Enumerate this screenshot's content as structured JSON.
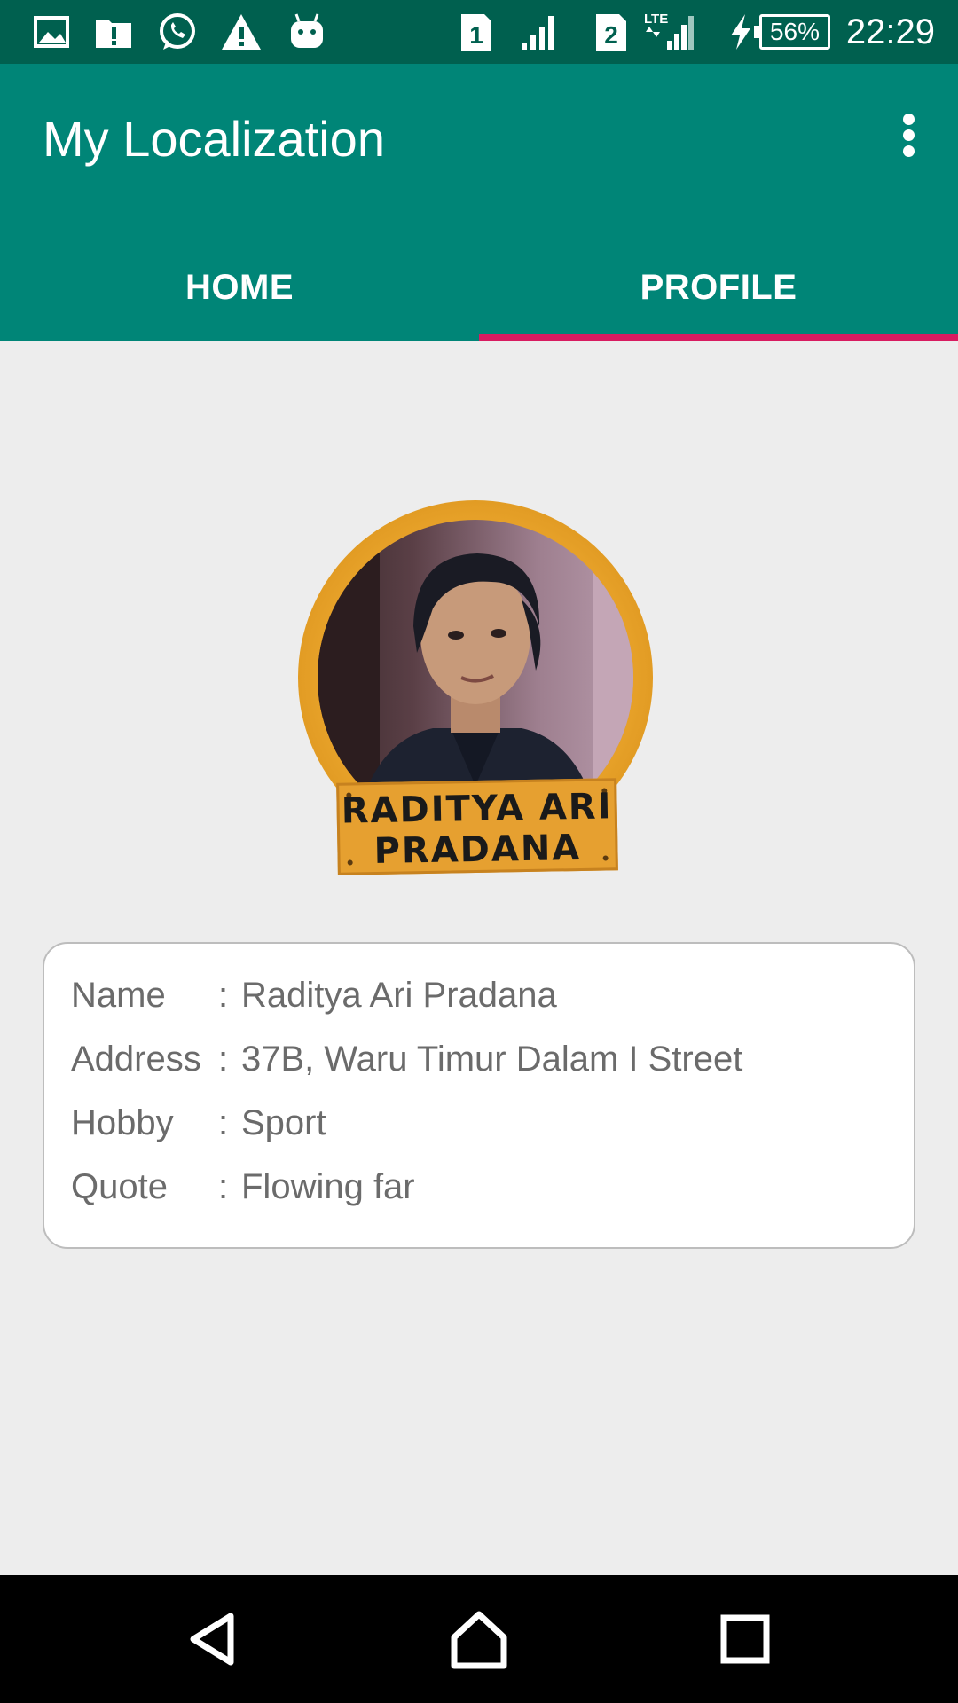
{
  "status_bar": {
    "icons": [
      "gallery-icon",
      "file-alert-icon",
      "whatsapp-icon",
      "warning-icon",
      "android-icon",
      "sim1-icon",
      "signal-icon",
      "sim2-icon",
      "lte-signal-icon",
      "charging-icon"
    ],
    "lte_label": "LTE",
    "sim1_label": "1",
    "sim2_label": "2",
    "battery": "56%",
    "time": "22:29"
  },
  "app_bar": {
    "title": "My Localization",
    "menu_icon": "overflow-menu-icon",
    "color": "#008577"
  },
  "tabs": [
    {
      "label": "HOME",
      "active": false
    },
    {
      "label": "PROFILE",
      "active": true
    }
  ],
  "profile": {
    "banner_line1": "RADITYA ARI",
    "banner_line2": "PRADANA",
    "details": [
      {
        "key": "Name",
        "sep": ":",
        "value": "Raditya Ari Pradana"
      },
      {
        "key": "Address",
        "sep": ":",
        "value": "37B, Waru Timur Dalam I Street"
      },
      {
        "key": "Hobby",
        "sep": ":",
        "value": "Sport"
      },
      {
        "key": "Quote",
        "sep": ":",
        "value": "Flowing far"
      }
    ]
  },
  "nav_bar": {
    "icons": [
      "back-icon",
      "home-icon",
      "recents-icon"
    ]
  },
  "colors": {
    "status_bar": "#00604f",
    "accent": "#d81b60",
    "background": "#ededed"
  }
}
